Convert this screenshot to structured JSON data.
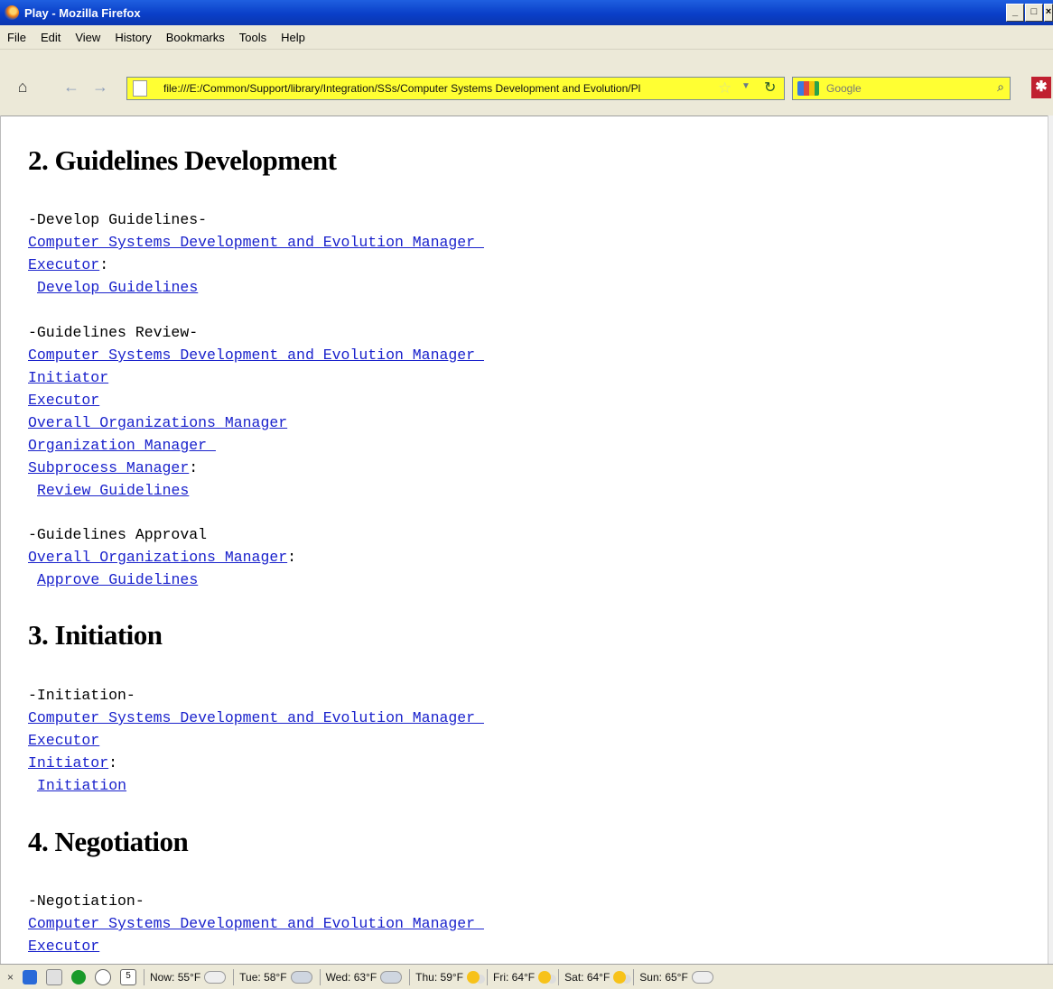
{
  "window": {
    "title": "Play - Mozilla Firefox"
  },
  "menu": [
    "File",
    "Edit",
    "View",
    "History",
    "Bookmarks",
    "Tools",
    "Help"
  ],
  "nav": {
    "url": "file:///E:/Common/Support/library/Integration/SSs/Computer Systems Development and Evolution/Pl",
    "search_placeholder": "Google",
    "icons": [
      "home-icon",
      "back-icon",
      "forward-icon",
      "star-icon",
      "reload-icon",
      "search-icon"
    ],
    "highlight_color": "#ffff33"
  },
  "content": {
    "sections": [
      {
        "title": "2. Guidelines Development",
        "groups": [
          {
            "heading": "-Develop Guidelines-",
            "roles": [
              "Computer Systems Development and Evolution Manager ",
              "Executor"
            ],
            "activity": "Develop Guidelines"
          },
          {
            "heading": "-Guidelines Review-",
            "roles": [
              "Computer Systems Development and Evolution Manager ",
              "Initiator",
              "Executor",
              "Overall Organizations Manager",
              "Organization Manager ",
              "Subprocess Manager"
            ],
            "activity": "Review Guidelines"
          },
          {
            "heading": "-Guidelines Approval",
            "roles": [
              "Overall Organizations Manager"
            ],
            "activity": "Approve Guidelines"
          }
        ]
      },
      {
        "title": "3. Initiation",
        "groups": [
          {
            "heading": "-Initiation-",
            "roles": [
              "Computer Systems Development and Evolution Manager ",
              "Executor",
              "Initiator"
            ],
            "activity": "Initiation"
          }
        ]
      },
      {
        "title": "4. Negotiation",
        "groups": [
          {
            "heading": "-Negotiation-",
            "roles": [
              "Computer Systems Development and Evolution Manager ",
              "Executor"
            ],
            "activity": ""
          }
        ]
      }
    ]
  },
  "status": {
    "weather": [
      {
        "label": "Now: 55°F",
        "icon": "cloud-icon"
      },
      {
        "label": "Tue: 58°F",
        "icon": "rain-cloud-icon"
      },
      {
        "label": "Wed: 63°F",
        "icon": "rain-cloud-icon"
      },
      {
        "label": "Thu: 59°F",
        "icon": "partly-sunny-icon"
      },
      {
        "label": "Fri: 64°F",
        "icon": "partly-sunny-icon"
      },
      {
        "label": "Sat: 64°F",
        "icon": "partly-sunny-icon"
      },
      {
        "label": "Sun: 65°F",
        "icon": "cloud-icon"
      }
    ],
    "calendar_day": "5"
  }
}
